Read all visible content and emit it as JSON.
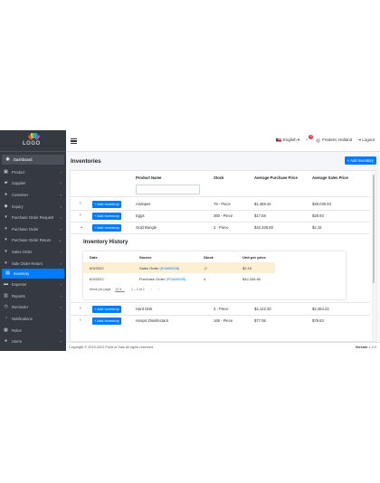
{
  "brand": {
    "logo_text": "LOGO",
    "colors": [
      "#e74c3c",
      "#f1c40f",
      "#2ecc71",
      "#3498db",
      "#9b59b6"
    ]
  },
  "sidebar": {
    "items": [
      {
        "label": "Dashboard",
        "icon": "dashboard-icon",
        "chevron": ""
      },
      {
        "label": "Product",
        "icon": "product-icon",
        "chevron": "‹"
      },
      {
        "label": "Supplier",
        "icon": "truck-icon",
        "chevron": "‹"
      },
      {
        "label": "Customer",
        "icon": "users-icon",
        "chevron": "‹"
      },
      {
        "label": "Inquiry",
        "icon": "inquiry-icon",
        "chevron": "‹"
      },
      {
        "label": "Purchase Order Request",
        "icon": "cart-icon",
        "chevron": "‹"
      },
      {
        "label": "Purchase Order",
        "icon": "cart-icon",
        "chevron": "‹"
      },
      {
        "label": "Purchase Order Return",
        "icon": "cart-icon",
        "chevron": "⌄"
      },
      {
        "label": "Sales Order",
        "icon": "cart-icon",
        "chevron": "‹"
      },
      {
        "label": "Sale Order Return",
        "icon": "cart-icon",
        "chevron": "‹"
      },
      {
        "label": "Inventory",
        "icon": "inventory-icon",
        "chevron": ""
      },
      {
        "label": "Expense",
        "icon": "expense-icon",
        "chevron": "‹"
      },
      {
        "label": "Reports",
        "icon": "reports-icon",
        "chevron": "‹"
      },
      {
        "label": "Reminder",
        "icon": "reminder-icon",
        "chevron": "‹"
      },
      {
        "label": "Notifications",
        "icon": "bell-icon",
        "chevron": ""
      },
      {
        "label": "Roles",
        "icon": "roles-icon",
        "chevron": "‹"
      },
      {
        "label": "Users",
        "icon": "users-icon",
        "chevron": "‹"
      }
    ]
  },
  "topbar": {
    "language": "English",
    "notification_count": "6",
    "user_name": "Frederic Holland",
    "logout": "Logout"
  },
  "page": {
    "title": "Inventories",
    "add_button": "+ Add Inventory"
  },
  "table": {
    "headers": [
      "Product Name",
      "Stock",
      "Average Purchase Price",
      "Average Sales Price"
    ],
    "row_button": "+ Add Inventory",
    "rows": [
      {
        "chevron": "›",
        "product": "Airdopes",
        "stock": "78 - Piece",
        "purchase": "$1,469.42",
        "sales": "$28,030.83"
      },
      {
        "chevron": "›",
        "product": "Eggs",
        "stock": "360 - Piece",
        "purchase": "$17.58",
        "sales": "$28.93"
      },
      {
        "chevron": "⌄",
        "product": "Gold Bangle",
        "stock": "2 - Piece",
        "purchase": "$42,336.80",
        "sales": "$2.16"
      },
      {
        "chevron": "›",
        "product": "Hard Disk",
        "stock": "3 - Piece",
        "purchase": "$4,122.33",
        "sales": "$2,454.23"
      },
      {
        "chevron": "›",
        "product": "Hospic Disinfectant",
        "stock": "165 - Piece",
        "purchase": "$77.06",
        "sales": "$79.63"
      }
    ]
  },
  "history": {
    "title": "Inventory History",
    "headers": [
      "Date",
      "Source",
      "Stock",
      "Unit per price"
    ],
    "rows": [
      {
        "date": "6/3/2022",
        "source": "Sales Order",
        "ref": "(SO#00028)",
        "stock": "-2",
        "price": "$2.16"
      },
      {
        "date": "6/3/2022",
        "source": "Purchase Order",
        "ref": "(PO#00026)",
        "stock": "4",
        "price": "$42,336.80"
      }
    ],
    "items_per_page_label": "Items per page:",
    "items_per_page": "10",
    "range": "1 – 2 of 2"
  },
  "footer": {
    "copyright": "Copyright © 2019-2022 Point of Sale All rights reserved.",
    "version_label": "Version",
    "version": "1.0.0"
  }
}
